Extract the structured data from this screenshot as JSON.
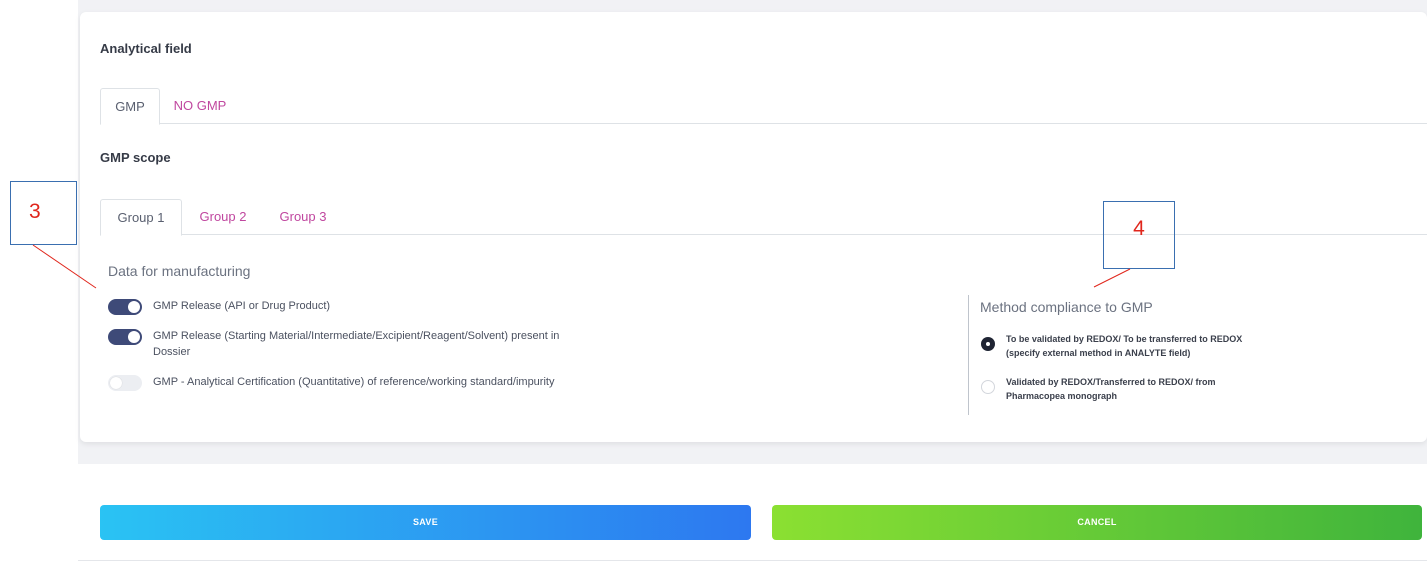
{
  "card": {
    "title": "Analytical field"
  },
  "main_tabs": [
    {
      "label": "GMP",
      "active": true
    },
    {
      "label": "NO GMP",
      "active": false
    }
  ],
  "gmp_scope": {
    "title": "GMP scope",
    "group_tabs": [
      {
        "label": "Group 1",
        "active": true
      },
      {
        "label": "Group 2",
        "active": false
      },
      {
        "label": "Group 3",
        "active": false
      }
    ]
  },
  "manufacturing": {
    "title": "Data for manufacturing",
    "toggles": [
      {
        "label": "GMP Release (API or Drug Product)",
        "on": true
      },
      {
        "label": "GMP Release (Starting Material/Intermediate/Excipient/Reagent/Solvent) present in Dossier",
        "on": true
      },
      {
        "label": "GMP - Analytical Certification (Quantitative) of reference/working standard/impurity",
        "on": false
      }
    ]
  },
  "compliance": {
    "title": "Method compliance to GMP",
    "options": [
      {
        "label": "To be validated by REDOX/ To be transferred to REDOX (specify external method in ANALYTE field)",
        "checked": true
      },
      {
        "label": "Validated by REDOX/Transferred to REDOX/ from Pharmacopea monograph",
        "checked": false
      }
    ]
  },
  "annotations": {
    "a3": "3",
    "a4": "4",
    "color_box": "#3a6fb0",
    "color_text": "#e0261c"
  },
  "buttons": {
    "save": "SAVE",
    "cancel": "CANCEL"
  },
  "colors": {
    "accent_link": "#c0479f",
    "toggle_on": "#3e4a78"
  }
}
